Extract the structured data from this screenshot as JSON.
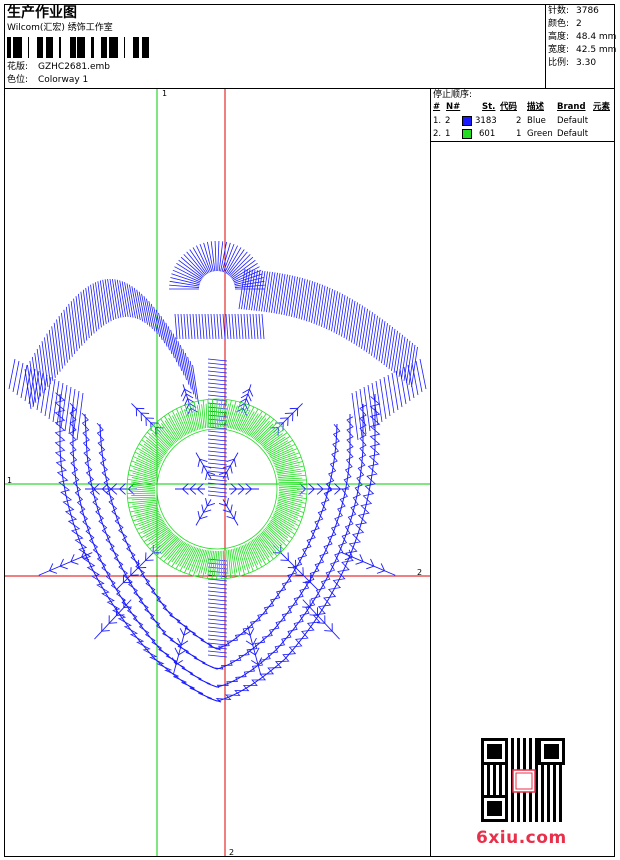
{
  "header": {
    "title": "生产作业图",
    "company": "Wilcom(汇宏) 绣饰工作室",
    "pattern_label": "花版:",
    "pattern_value": "GZHC2681.emb",
    "colorway_label": "色位:",
    "colorway_value": "Colorway 1"
  },
  "stats": [
    {
      "label": "针数:",
      "value": "3786"
    },
    {
      "label": "颜色:",
      "value": "2"
    },
    {
      "label": "高度:",
      "value": "48.4 mm"
    },
    {
      "label": "宽度:",
      "value": "42.5 mm"
    },
    {
      "label": "比例:",
      "value": "3.30"
    }
  ],
  "stop_sequence": {
    "title": "停止顺序:",
    "headers": [
      "#",
      "N#",
      "St.",
      "代码",
      "描述",
      "Brand",
      "元素"
    ],
    "rows": [
      {
        "num": "1.",
        "needle": "2",
        "color": "#1a1aff",
        "stitches": "3183",
        "code": "2",
        "desc": "Blue",
        "brand": "Default"
      },
      {
        "num": "2.",
        "needle": "1",
        "color": "#22dd22",
        "stitches": "601",
        "code": "1",
        "desc": "Green",
        "brand": "Default"
      }
    ]
  },
  "guides": {
    "green": "1",
    "red": "2"
  },
  "colors": {
    "blue": "#1a1aff",
    "green": "#22dd22",
    "guide_green": "#00cc00",
    "guide_red": "#dd0000"
  },
  "watermark": {
    "text": "6xiu.com"
  }
}
